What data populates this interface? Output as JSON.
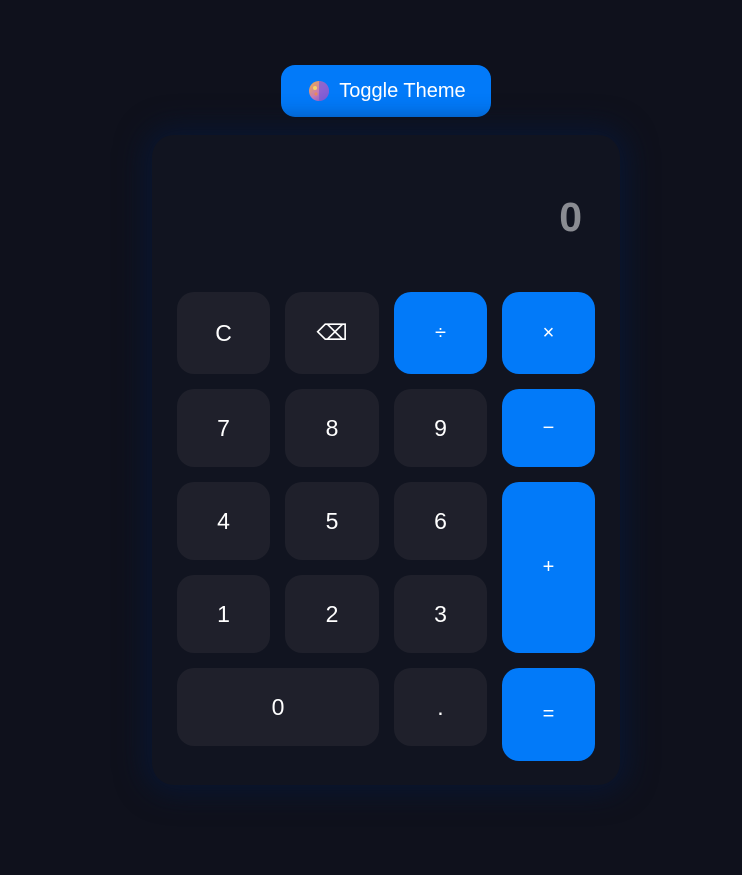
{
  "theme_toggle": {
    "icon": "theme-palette-icon",
    "label": "Toggle Theme"
  },
  "display": {
    "value": "0"
  },
  "keys": {
    "clear": "C",
    "backspace": "⌫",
    "divide": "÷",
    "multiply": "×",
    "seven": "7",
    "eight": "8",
    "nine": "9",
    "subtract": "−",
    "four": "4",
    "five": "5",
    "six": "6",
    "add": "+",
    "one": "1",
    "two": "2",
    "three": "3",
    "zero": "0",
    "decimal": ".",
    "equals": "="
  },
  "colors": {
    "background": "#0f111c",
    "panel": "#111420",
    "number_key": "#1f202b",
    "accent": "#027af9",
    "display_text": "#8a8c92"
  }
}
